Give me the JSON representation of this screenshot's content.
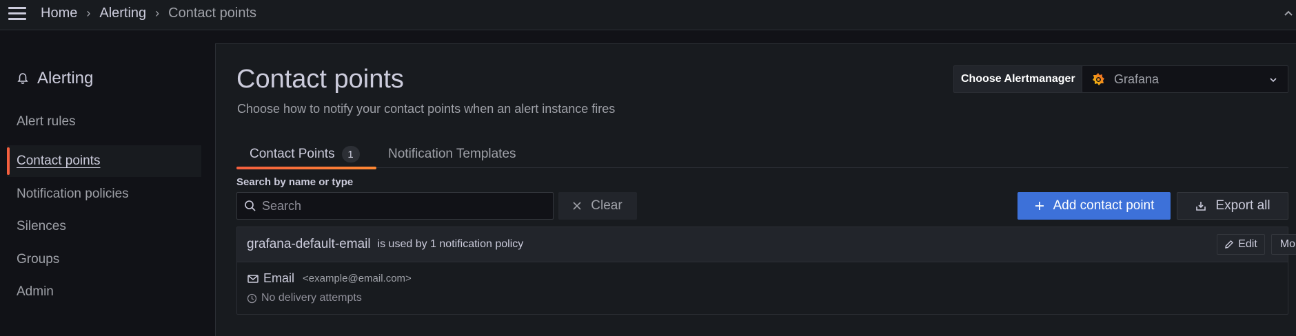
{
  "breadcrumb": {
    "items": [
      "Home",
      "Alerting",
      "Contact points"
    ],
    "separator": "›"
  },
  "sidebar": {
    "title": "Alerting",
    "items": [
      {
        "label": "Alert rules",
        "active": false
      },
      {
        "label": "Contact points",
        "active": true
      },
      {
        "label": "Notification policies",
        "active": false
      },
      {
        "label": "Silences",
        "active": false
      },
      {
        "label": "Groups",
        "active": false
      },
      {
        "label": "Admin",
        "active": false
      }
    ]
  },
  "header": {
    "title": "Contact points",
    "subtitle": "Choose how to notify your contact points when an alert instance fires",
    "alertmanager_label": "Choose Alertmanager",
    "alertmanager_value": "Grafana"
  },
  "tabs": [
    {
      "label": "Contact Points",
      "count": "1",
      "active": true
    },
    {
      "label": "Notification Templates",
      "active": false
    }
  ],
  "search": {
    "label": "Search by name or type",
    "placeholder": "Search",
    "value": "",
    "clear_label": "Clear"
  },
  "actions": {
    "add_label": "Add contact point",
    "export_label": "Export all"
  },
  "contact_points": [
    {
      "name": "grafana-default-email",
      "used_by_prefix": "is used by",
      "used_by_count": "1",
      "used_by_suffix": "notification policy",
      "edit_label": "Edit",
      "more_label": "More",
      "integration_type": "Email",
      "integration_address": "<example@email.com>",
      "delivery_status": "No delivery attempts"
    }
  ],
  "colors": {
    "accent": "#f55f3e",
    "primary_button": "#3d71d9",
    "background": "#111217",
    "panel": "#181b1f"
  },
  "icons": {
    "menu": "hamburger-icon",
    "sidebar_title": "bell-icon",
    "alertmanager": "grafana-logo-icon",
    "search": "search-icon",
    "clear": "close-icon",
    "add": "plus-icon",
    "export": "download-icon",
    "edit": "pen-icon",
    "more": "chevron-down-icon",
    "email": "envelope-icon",
    "delivery": "clock-icon"
  }
}
